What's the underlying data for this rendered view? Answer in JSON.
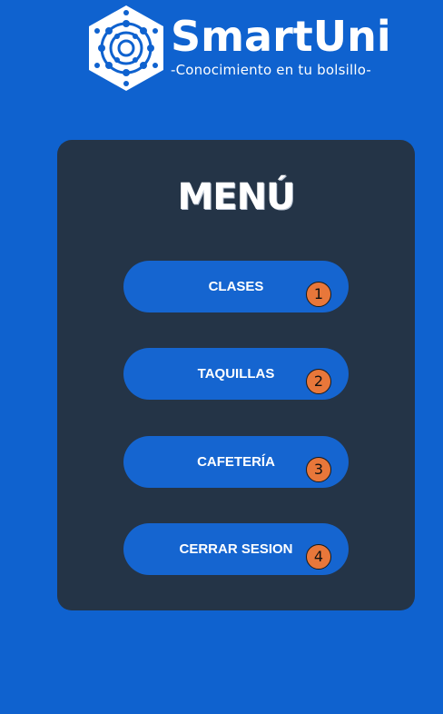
{
  "header": {
    "brand": "SmartUni",
    "tagline": "-Conocimiento en tu bolsillo-",
    "logo_icon": "mandala-logo-icon"
  },
  "menu": {
    "title": "MENÚ",
    "items": [
      {
        "label": "CLASES",
        "badge": "1"
      },
      {
        "label": "TAQUILLAS",
        "badge": "2"
      },
      {
        "label": "CAFETERÍA",
        "badge": "3"
      },
      {
        "label": "CERRAR SESION",
        "badge": "4"
      }
    ]
  },
  "colors": {
    "background": "#0f62cf",
    "panel": "#243447",
    "button": "#1565d0",
    "badge": "#e8773a",
    "text": "#ffffff"
  }
}
